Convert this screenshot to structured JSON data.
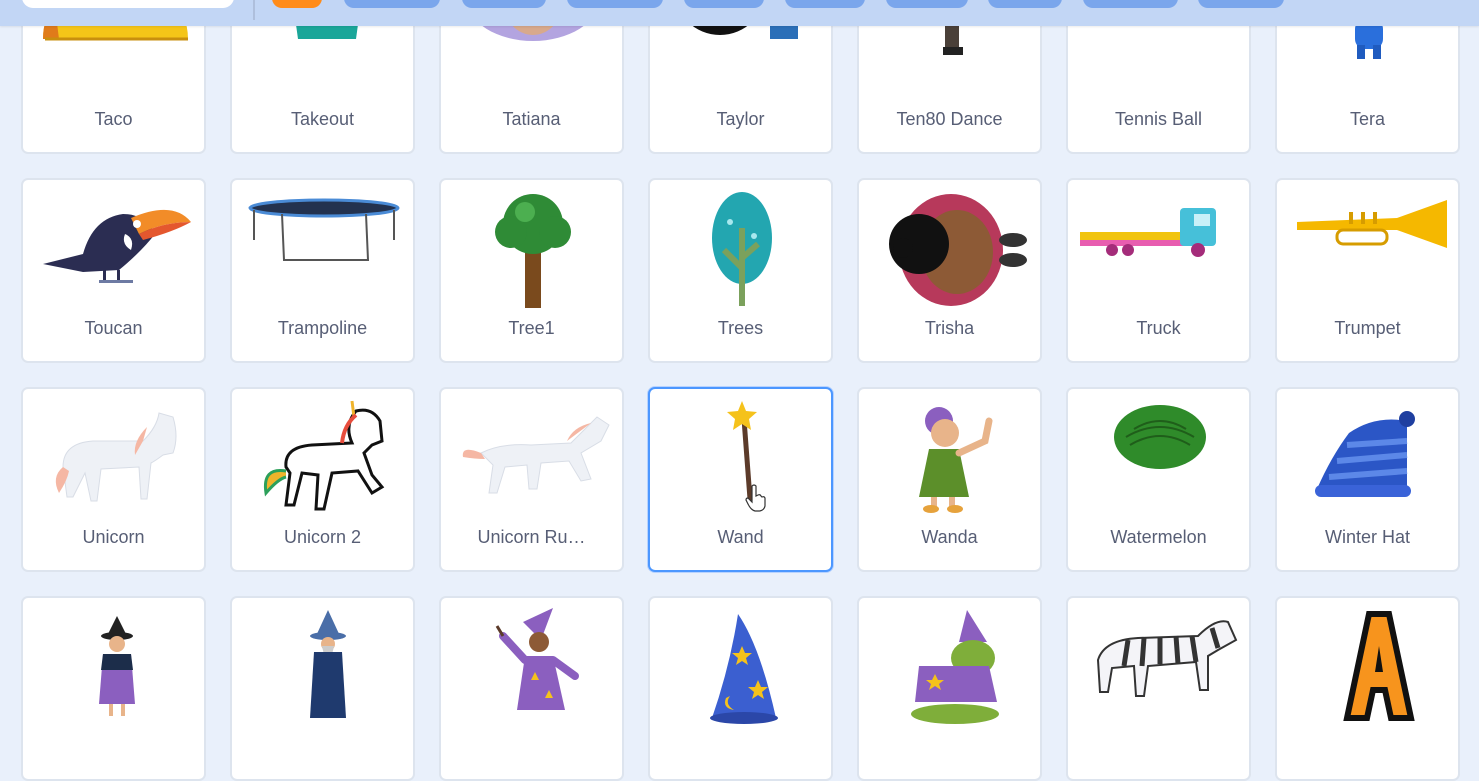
{
  "colors": {
    "background": "#e9f0fb",
    "topbar": "#c2d6f5",
    "chip": "#7aa6ec",
    "chip_active": "#ff8c1a",
    "card_border": "#dde4ee",
    "selected_border": "#4c97ff",
    "label_text": "#575e75"
  },
  "library": {
    "sprites": [
      {
        "label": "Taco",
        "icon": "taco-icon"
      },
      {
        "label": "Takeout",
        "icon": "takeout-icon"
      },
      {
        "label": "Tatiana",
        "icon": "tatiana-icon"
      },
      {
        "label": "Taylor",
        "icon": "taylor-icon"
      },
      {
        "label": "Ten80 Dance",
        "icon": "ten80-dance-icon"
      },
      {
        "label": "Tennis Ball",
        "icon": "tennis-ball-icon"
      },
      {
        "label": "Tera",
        "icon": "tera-icon"
      },
      {
        "label": "Toucan",
        "icon": "toucan-icon"
      },
      {
        "label": "Trampoline",
        "icon": "trampoline-icon"
      },
      {
        "label": "Tree1",
        "icon": "tree1-icon"
      },
      {
        "label": "Trees",
        "icon": "trees-icon"
      },
      {
        "label": "Trisha",
        "icon": "trisha-icon"
      },
      {
        "label": "Truck",
        "icon": "truck-icon"
      },
      {
        "label": "Trumpet",
        "icon": "trumpet-icon"
      },
      {
        "label": "Unicorn",
        "icon": "unicorn-icon"
      },
      {
        "label": "Unicorn 2",
        "icon": "unicorn-2-icon"
      },
      {
        "label": "Unicorn Ru…",
        "icon": "unicorn-running-icon"
      },
      {
        "label": "Wand",
        "icon": "wand-icon",
        "selected": true
      },
      {
        "label": "Wanda",
        "icon": "wanda-icon"
      },
      {
        "label": "Watermelon",
        "icon": "watermelon-icon"
      },
      {
        "label": "Winter Hat",
        "icon": "winter-hat-icon"
      },
      {
        "label": "",
        "icon": "witch-icon"
      },
      {
        "label": "",
        "icon": "wizard-icon"
      },
      {
        "label": "",
        "icon": "wizard-girl-icon"
      },
      {
        "label": "",
        "icon": "wizard-hat-icon"
      },
      {
        "label": "",
        "icon": "wizard-toad-icon"
      },
      {
        "label": "",
        "icon": "zebra-icon"
      },
      {
        "label": "",
        "icon": "letter-a-icon"
      }
    ]
  },
  "cursor": {
    "icon": "hand-pointer-icon"
  }
}
